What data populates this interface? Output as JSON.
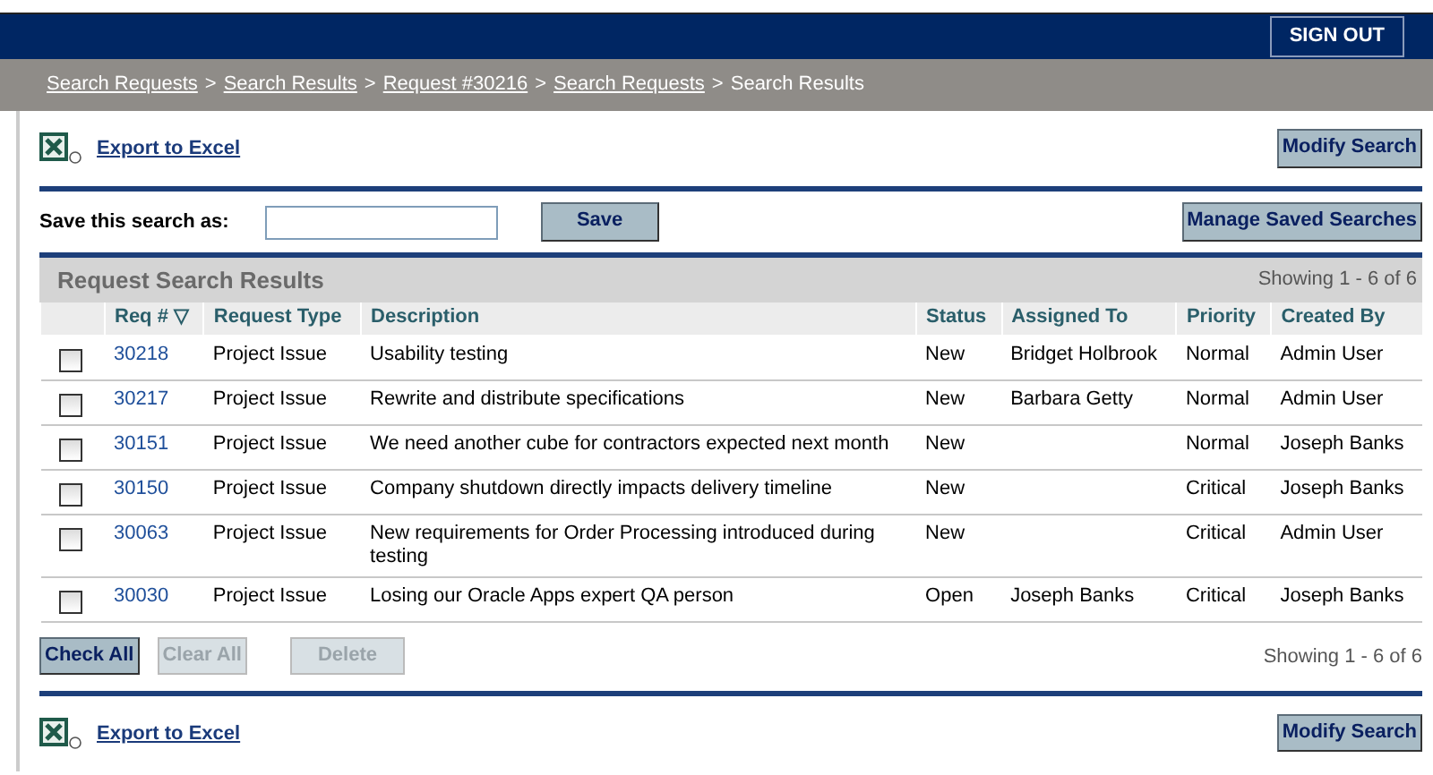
{
  "header": {
    "sign_out": "SIGN OUT"
  },
  "breadcrumb": [
    {
      "label": "Search Requests",
      "link": true
    },
    {
      "separator": ">",
      "label": "Search Results",
      "link": true
    },
    {
      "separator": ">",
      "label": "Request #30216",
      "link": true
    },
    {
      "separator": ">",
      "label": "Search Requests",
      "link": true
    },
    {
      "separator": ">",
      "label": "Search Results",
      "link": false
    }
  ],
  "top_toolbar": {
    "export": "Export to Excel",
    "modify": "Modify Search"
  },
  "save_search": {
    "label": "Save this search as:",
    "save": "Save",
    "manage": "Manage Saved Searches"
  },
  "results": {
    "title": "Request Search Results",
    "showing": "Showing 1 - 6 of 6",
    "columns": [
      {
        "label": "Req #",
        "sort": "▽"
      },
      {
        "label": "Request Type"
      },
      {
        "label": "Description"
      },
      {
        "label": "Status"
      },
      {
        "label": "Assigned To"
      },
      {
        "label": "Priority"
      },
      {
        "label": "Created By"
      }
    ],
    "rows": [
      {
        "checked": false,
        "id": "30218",
        "type": "Project Issue",
        "description": "Usability testing",
        "status": "New",
        "assigned_to": "Bridget Holbrook",
        "priority": "Normal",
        "created_by": "Admin User"
      },
      {
        "checked": false,
        "id": "30217",
        "type": "Project Issue",
        "description": "Rewrite and distribute specifications",
        "status": "New",
        "assigned_to": "Barbara Getty",
        "priority": "Normal",
        "created_by": "Admin User"
      },
      {
        "checked": false,
        "id": "30151",
        "type": "Project Issue",
        "description": "We need another cube for contractors expected next month",
        "status": "New",
        "priority": "Normal",
        "created_by": "Joseph Banks"
      },
      {
        "checked": false,
        "id": "30150",
        "type": "Project Issue",
        "description": "Company shutdown directly impacts delivery timeline",
        "status": "New",
        "priority": "Critical",
        "created_by": "Joseph Banks"
      },
      {
        "checked": false,
        "id": "30063",
        "type": "Project Issue",
        "description": "New requirements for Order Processing introduced during testing",
        "status": "New",
        "priority": "Critical",
        "created_by": "Admin User"
      },
      {
        "checked": false,
        "id": "30030",
        "type": "Project Issue",
        "description": "Losing our Oracle Apps expert QA person",
        "status": "Open",
        "assigned_to": "Joseph Banks",
        "priority": "Critical",
        "created_by": "Joseph Banks"
      }
    ],
    "actions": [
      {
        "label": "Check All",
        "disabled": false
      },
      {
        "label": "Clear All",
        "disabled": true
      },
      {
        "label": "Delete",
        "disabled": true
      }
    ],
    "showing_bottom": "Showing 1 - 6 of 6"
  },
  "bottom_toolbar": {
    "export": "Export to Excel",
    "modify": "Modify Search"
  }
}
